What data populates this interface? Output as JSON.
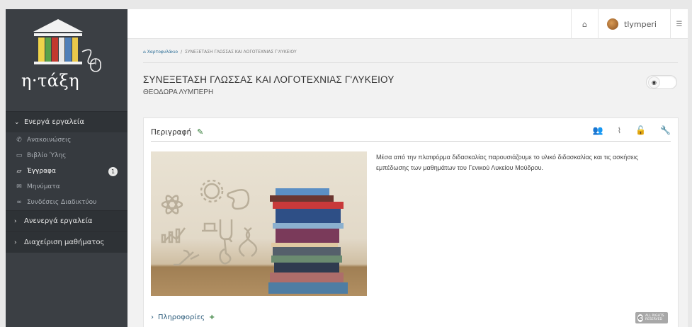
{
  "app": {
    "logo_text": "η·τάξη"
  },
  "topbar": {
    "home_icon": "home-icon",
    "username": "tlymperi",
    "settings_icon": "sliders-icon"
  },
  "sidebar": {
    "active_tools": {
      "label": "Ενεργά εργαλεία",
      "items": [
        {
          "label": "Ανακοινώσεις",
          "icon": "megaphone-icon"
        },
        {
          "label": "Βιβλίο Ύλης",
          "icon": "calendar-icon"
        },
        {
          "label": "Έγγραφα",
          "icon": "folder-icon",
          "badge": "1"
        },
        {
          "label": "Μηνύματα",
          "icon": "envelope-icon"
        },
        {
          "label": "Συνδέσεις Διαδικτύου",
          "icon": "link-icon"
        }
      ]
    },
    "inactive_tools": {
      "label": "Ανενεργά εργαλεία"
    },
    "course_admin": {
      "label": "Διαχείριση μαθήματος"
    }
  },
  "breadcrumb": {
    "home": "Χαρτοφυλάκιο",
    "separator": "/",
    "current": "ΣΥΝΕΞΕΤΑΣΗ ΓΛΩΣΣΑΣ ΚΑΙ ΛΟΓΟΤΕΧΝΙΑΣ Γ'ΛΥΚΕΙΟΥ"
  },
  "course": {
    "title": "ΣΥΝΕΞΕΤΑΣΗ ΓΛΩΣΣΑΣ ΚΑΙ ΛΟΓΟΤΕΧΝΙΑΣ Γ'ΛΥΚΕΙΟΥ",
    "teacher": "ΘΕΟΔΩΡΑ ΛΥΜΠΕΡΗ"
  },
  "panel": {
    "title": "Περιγραφή",
    "description": "Μέσα από την πλατφόρμα διδασκαλίας παρουσιάζουμε το υλικό διδασκαλίας και τις ασκήσεις εμπέδωσης των μαθημάτων του Γενικού Λυκείου Μούδρου.",
    "info_label": "Πληροφορίες",
    "license_text": "ALL RIGHTS RESERVED"
  },
  "colors": {
    "sidebar_bg": "#3b3f44",
    "accent_blue": "#2b6d96",
    "accent_green": "#2d7a32"
  }
}
